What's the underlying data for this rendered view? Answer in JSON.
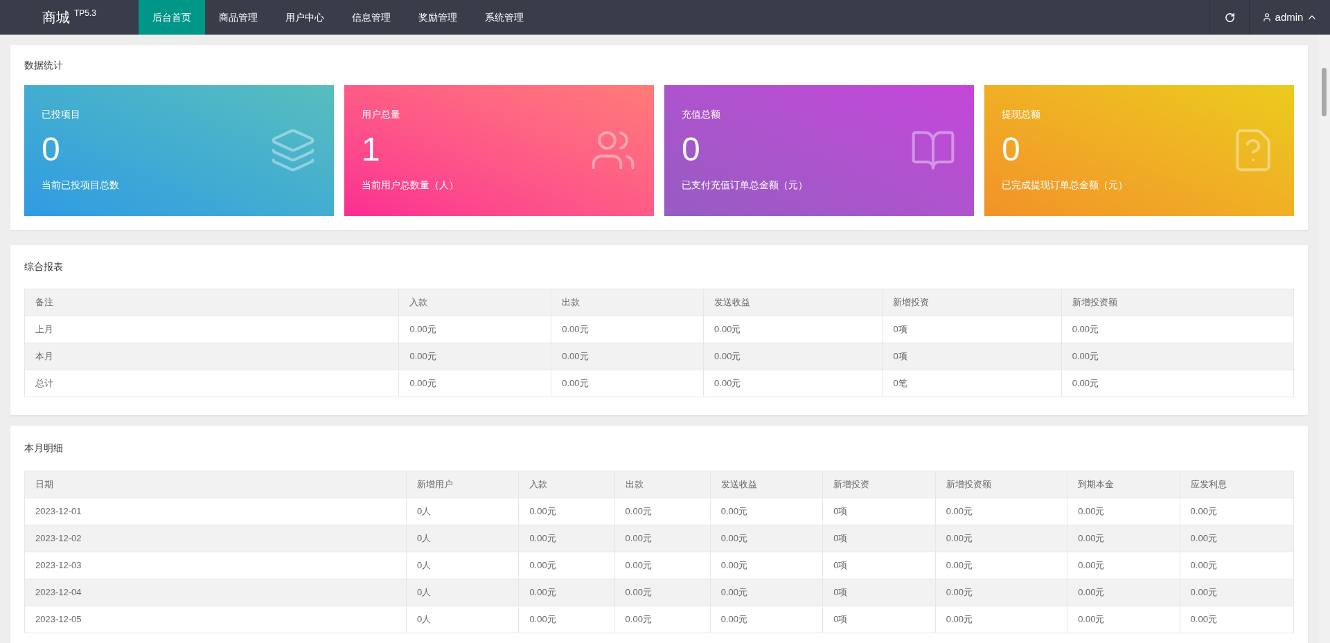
{
  "header": {
    "logo": "商城",
    "version": "TP5.3",
    "tabs": [
      {
        "label": "后台首页",
        "selected": true
      },
      {
        "label": "商品管理",
        "selected": false
      },
      {
        "label": "用户中心",
        "selected": false
      },
      {
        "label": "信息管理",
        "selected": false
      },
      {
        "label": "奖励管理",
        "selected": false
      },
      {
        "label": "系统管理",
        "selected": false
      }
    ],
    "user": "admin"
  },
  "stats": {
    "title": "数据统计",
    "cards": [
      {
        "kind": "layers",
        "label": "已投项目",
        "value": "0",
        "caption": "当前已投项目总数"
      },
      {
        "kind": "users",
        "label": "用户总量",
        "value": "1",
        "caption": "当前用户总数量（人）"
      },
      {
        "kind": "book",
        "label": "充值总额",
        "value": "0",
        "caption": "已支付充值订单总金额（元）"
      },
      {
        "kind": "question",
        "label": "提现总额",
        "value": "0",
        "caption": "已完成提现订单总金额（元）"
      }
    ]
  },
  "report": {
    "title": "综合报表",
    "columns": [
      "备注",
      "入款",
      "出款",
      "发送收益",
      "新增投资",
      "新增投资额"
    ],
    "rows": [
      [
        "上月",
        "0.00元",
        "0.00元",
        "0.00元",
        "0项",
        "0.00元"
      ],
      [
        "本月",
        "0.00元",
        "0.00元",
        "0.00元",
        "0项",
        "0.00元"
      ],
      [
        "总计",
        "0.00元",
        "0.00元",
        "0.00元",
        "0笔",
        "0.00元"
      ]
    ]
  },
  "detail": {
    "title": "本月明细",
    "columns": [
      "日期",
      "新增用户",
      "入款",
      "出款",
      "发送收益",
      "新增投资",
      "新增投资额",
      "到期本金",
      "应发利息"
    ],
    "rows": [
      [
        "2023-12-01",
        "0人",
        "0.00元",
        "0.00元",
        "0.00元",
        "0项",
        "0.00元",
        "0.00元",
        "0.00元"
      ],
      [
        "2023-12-02",
        "0人",
        "0.00元",
        "0.00元",
        "0.00元",
        "0项",
        "0.00元",
        "0.00元",
        "0.00元"
      ],
      [
        "2023-12-03",
        "0人",
        "0.00元",
        "0.00元",
        "0.00元",
        "0项",
        "0.00元",
        "0.00元",
        "0.00元"
      ],
      [
        "2023-12-04",
        "0人",
        "0.00元",
        "0.00元",
        "0.00元",
        "0项",
        "0.00元",
        "0.00元",
        "0.00元"
      ],
      [
        "2023-12-05",
        "0人",
        "0.00元",
        "0.00元",
        "0.00元",
        "0项",
        "0.00元",
        "0.00元",
        "0.00元"
      ]
    ]
  }
}
